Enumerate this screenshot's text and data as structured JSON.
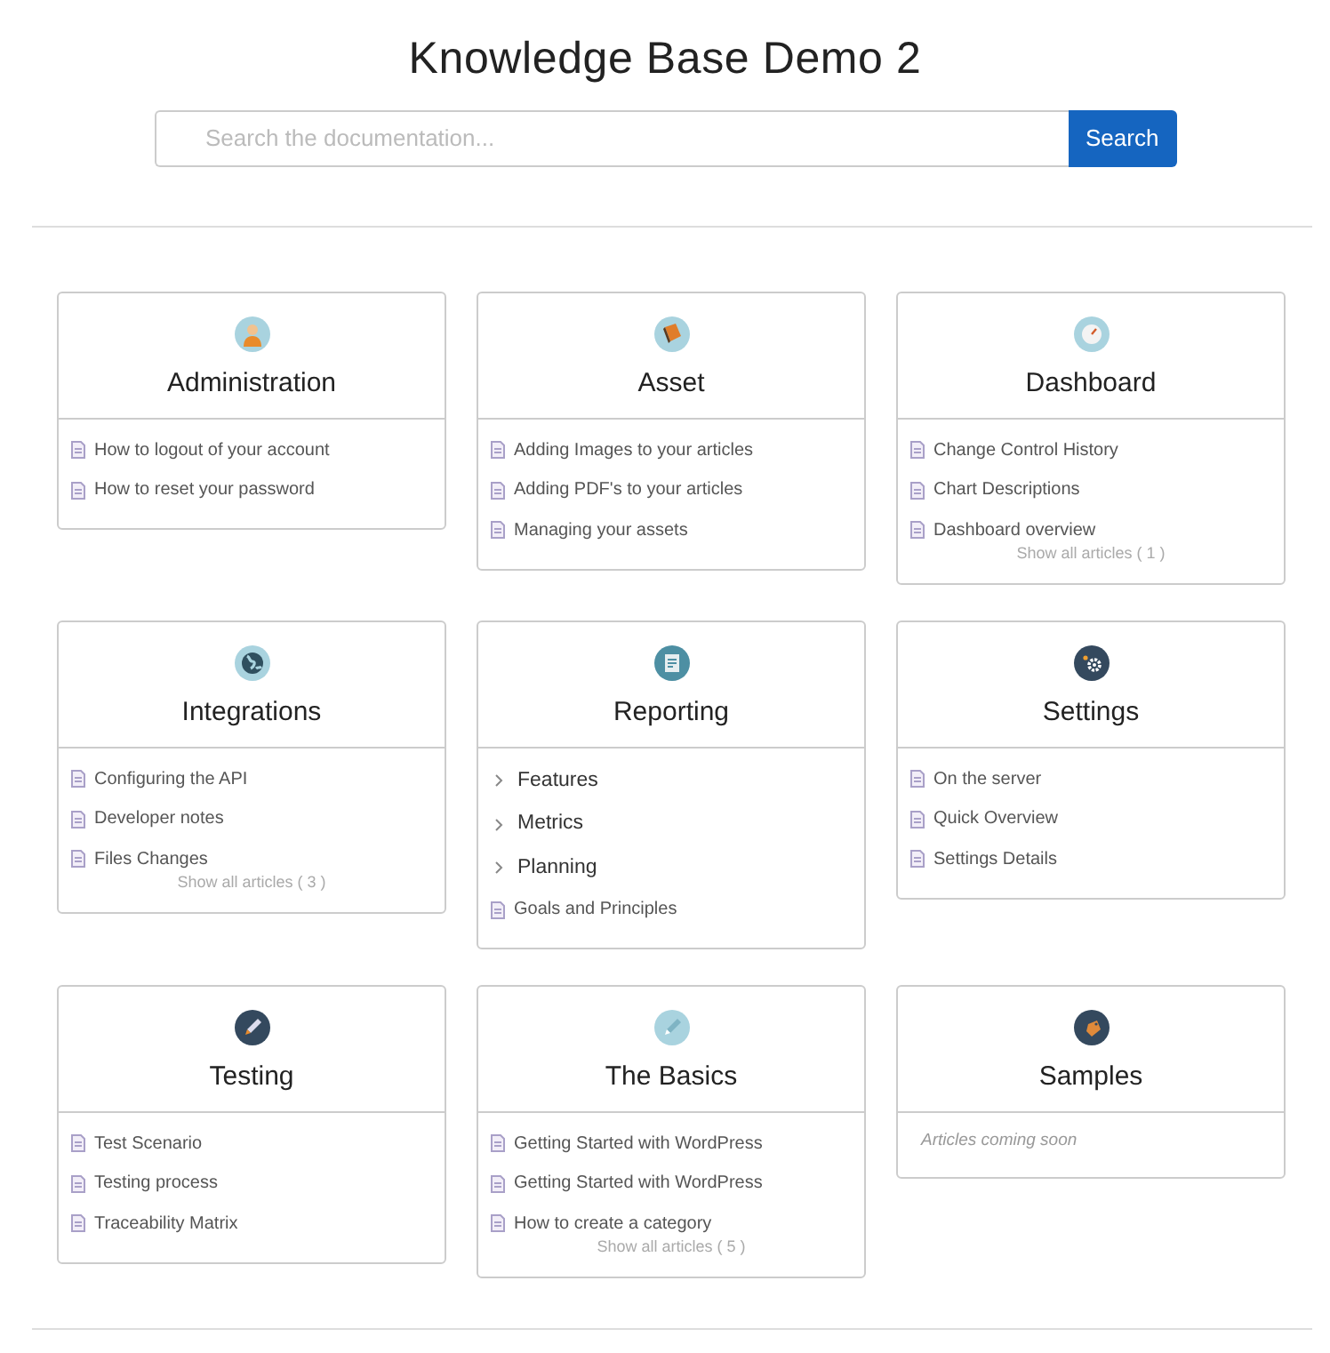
{
  "title": "Knowledge Base Demo 2",
  "search": {
    "placeholder": "Search the documentation...",
    "button": "Search"
  },
  "categories": [
    {
      "title": "Administration",
      "items": [
        {
          "kind": "article",
          "label": "How to logout of your account"
        },
        {
          "kind": "article",
          "label": "How to reset your password"
        }
      ]
    },
    {
      "title": "Asset",
      "items": [
        {
          "kind": "article",
          "label": "Adding Images to your articles"
        },
        {
          "kind": "article",
          "label": "Adding PDF's to your articles"
        },
        {
          "kind": "article",
          "label": "Managing your assets"
        }
      ]
    },
    {
      "title": "Dashboard",
      "items": [
        {
          "kind": "article",
          "label": "Change Control History"
        },
        {
          "kind": "article",
          "label": "Chart Descriptions"
        },
        {
          "kind": "article",
          "label": "Dashboard overview"
        }
      ],
      "show_all": "Show all articles ( 1 )"
    },
    {
      "title": "Integrations",
      "items": [
        {
          "kind": "article",
          "label": "Configuring the API"
        },
        {
          "kind": "article",
          "label": "Developer notes"
        },
        {
          "kind": "article",
          "label": "Files Changes"
        }
      ],
      "show_all": "Show all articles ( 3 )"
    },
    {
      "title": "Reporting",
      "items": [
        {
          "kind": "folder",
          "label": "Features"
        },
        {
          "kind": "folder",
          "label": "Metrics"
        },
        {
          "kind": "folder",
          "label": "Planning"
        },
        {
          "kind": "article",
          "label": "Goals and Principles"
        }
      ]
    },
    {
      "title": "Settings",
      "items": [
        {
          "kind": "article",
          "label": "On the server"
        },
        {
          "kind": "article",
          "label": "Quick Overview"
        },
        {
          "kind": "article",
          "label": "Settings Details"
        }
      ]
    },
    {
      "title": "Testing",
      "items": [
        {
          "kind": "article",
          "label": "Test Scenario"
        },
        {
          "kind": "article",
          "label": "Testing process"
        },
        {
          "kind": "article",
          "label": "Traceability Matrix"
        }
      ]
    },
    {
      "title": "The Basics",
      "items": [
        {
          "kind": "article",
          "label": "Getting Started with WordPress"
        },
        {
          "kind": "article",
          "label": "Getting Started with WordPress"
        },
        {
          "kind": "article",
          "label": "How to create a category"
        }
      ],
      "show_all": "Show all articles ( 5 )"
    },
    {
      "title": "Samples",
      "empty_note": "Articles coming soon"
    }
  ]
}
